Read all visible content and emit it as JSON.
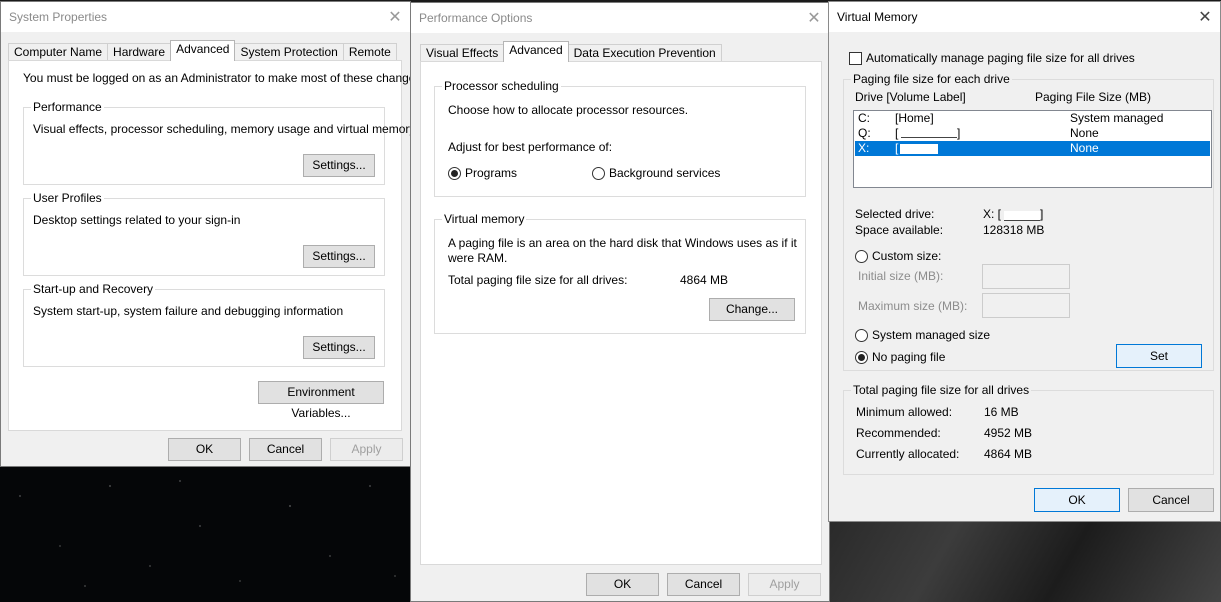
{
  "system_properties": {
    "title": "System Properties",
    "tabs": [
      "Computer Name",
      "Hardware",
      "Advanced",
      "System Protection",
      "Remote"
    ],
    "admin_note": "You must be logged on as an Administrator to make most of these changes.",
    "performance": {
      "label": "Performance",
      "desc": "Visual effects, processor scheduling, memory usage and virtual memory",
      "button": "Settings..."
    },
    "user_profiles": {
      "label": "User Profiles",
      "desc": "Desktop settings related to your sign-in",
      "button": "Settings..."
    },
    "startup_recovery": {
      "label": "Start-up and Recovery",
      "desc": "System start-up, system failure and debugging information",
      "button": "Settings..."
    },
    "env_button": "Environment Variables...",
    "ok": "OK",
    "cancel": "Cancel",
    "apply": "Apply"
  },
  "performance_options": {
    "title": "Performance Options",
    "tabs": [
      "Visual Effects",
      "Advanced",
      "Data Execution Prevention"
    ],
    "processor_scheduling": {
      "label": "Processor scheduling",
      "desc": "Choose how to allocate processor resources.",
      "adjust": "Adjust for best performance of:",
      "programs": "Programs",
      "background": "Background services"
    },
    "virtual_memory": {
      "label": "Virtual memory",
      "desc_line1": "A paging file is an area on the hard disk that Windows uses as if it",
      "desc_line2": "were RAM.",
      "total_label": "Total paging file size for all drives:",
      "total_value": "4864 MB",
      "change_button": "Change..."
    },
    "ok": "OK",
    "cancel": "Cancel",
    "apply": "Apply"
  },
  "virtual_memory": {
    "title": "Virtual Memory",
    "auto_manage": "Automatically manage paging file size for all drives",
    "group_each_drive": "Paging file size for each drive",
    "col_drive": "Drive  [Volume Label]",
    "col_size": "Paging File Size (MB)",
    "drives": [
      {
        "letter": "C:",
        "label": "[Home]",
        "size": "System managed"
      },
      {
        "letter": "Q:",
        "label": "[",
        "label_end": "]",
        "size": "None"
      },
      {
        "letter": "X:",
        "label": "[",
        "size": "None"
      }
    ],
    "selected_drive_label": "Selected drive:",
    "selected_drive_value": "X:  [",
    "selected_drive_end": "]",
    "space_label": "Space available:",
    "space_value": "128318 MB",
    "custom_size": "Custom size:",
    "initial_size": "Initial size (MB):",
    "maximum_size": "Maximum size (MB):",
    "system_managed": "System managed size",
    "no_paging": "No paging file",
    "set_button": "Set",
    "totals_group": "Total paging file size for all drives",
    "min_label": "Minimum allowed:",
    "min_value": "16 MB",
    "rec_label": "Recommended:",
    "rec_value": "4952 MB",
    "cur_label": "Currently allocated:",
    "cur_value": "4864 MB",
    "ok": "OK",
    "cancel": "Cancel"
  }
}
